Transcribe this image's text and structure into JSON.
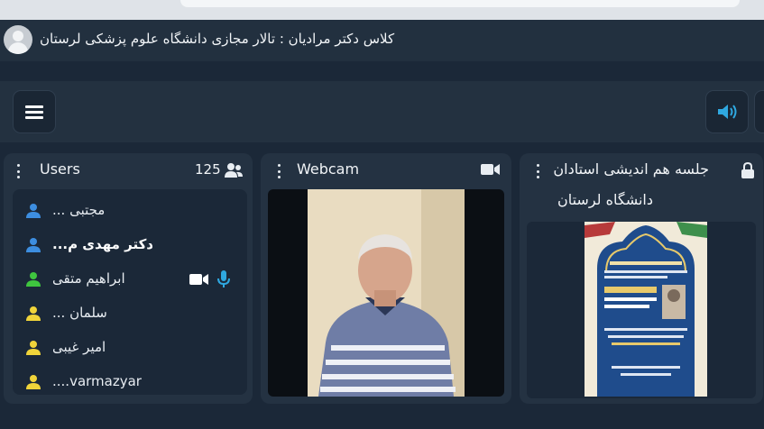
{
  "window": {
    "title": "کلاس دکتر مرادیان : تالار مجازی دانشگاه علوم پزشکی لرستان"
  },
  "users_panel": {
    "title": "Users",
    "count": "125",
    "users": [
      {
        "name": "مجتبی ...",
        "status_color": "#3d8ee0",
        "bold": false
      },
      {
        "name": "دکتر مهدی م...",
        "status_color": "#3d8ee0",
        "bold": true
      },
      {
        "name": "ابراهیم متقی",
        "status_color": "#3fc53f",
        "bold": false,
        "has_webcam": true,
        "has_mic": true
      },
      {
        "name": "سلمان ...",
        "status_color": "#f0d43a",
        "bold": false
      },
      {
        "name": "امیر غیبی",
        "status_color": "#f0d43a",
        "bold": false
      },
      {
        "name": "....varmazyar",
        "status_color": "#f0d43a",
        "bold": false
      }
    ]
  },
  "webcam_panel": {
    "title": "Webcam"
  },
  "presentation_panel": {
    "title_line1": "جلسه هم اندیشی استادان",
    "title_line2": "دانشگاه لرستان"
  },
  "colors": {
    "background": "#1b2838",
    "panel": "#243242",
    "accent_blue": "#3d8ee0",
    "audio_icon": "#2fa8e0"
  },
  "icons": {
    "menu": "hamburger-icon",
    "audio": "speaker-icon",
    "users": "users-group-icon",
    "webcam": "video-camera-icon",
    "lock": "lock-icon"
  }
}
